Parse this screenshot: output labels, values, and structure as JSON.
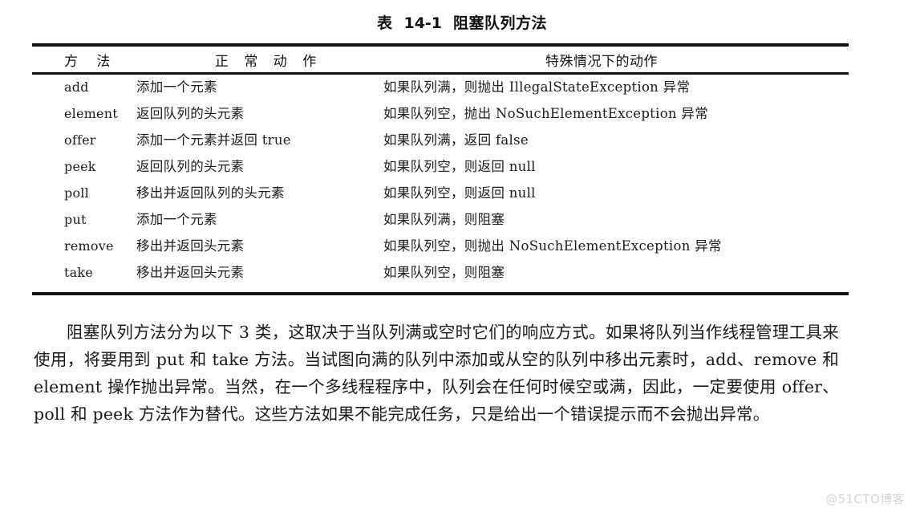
{
  "caption": {
    "prefix": "表",
    "number": "14-1",
    "title": "阻塞队列方法"
  },
  "table": {
    "headers": {
      "method": "方 法",
      "normal_action": "正 常 动 作",
      "special_action": "特殊情况下的动作"
    },
    "rows": [
      {
        "method": "add",
        "normal": "添加一个元素",
        "special": "如果队列满，则抛出 IllegalStateException 异常"
      },
      {
        "method": "element",
        "normal": "返回队列的头元素",
        "special": "如果队列空，抛出 NoSuchElementException 异常"
      },
      {
        "method": "offer",
        "normal": "添加一个元素并返回 true",
        "special": "如果队列满，返回 false"
      },
      {
        "method": "peek",
        "normal": "返回队列的头元素",
        "special": "如果队列空，则返回 null"
      },
      {
        "method": "poll",
        "normal": "移出并返回队列的头元素",
        "special": "如果队列空，则返回 null"
      },
      {
        "method": "put",
        "normal": "添加一个元素",
        "special": "如果队列满，则阻塞"
      },
      {
        "method": "remove",
        "normal": "移出并返回头元素",
        "special": "如果队列空，则抛出 NoSuchElementException 异常"
      },
      {
        "method": "take",
        "normal": "移出并返回头元素",
        "special": "如果队列空，则阻塞"
      }
    ]
  },
  "body": {
    "paragraph": "阻塞队列方法分为以下 3 类，这取决于当队列满或空时它们的响应方式。如果将队列当作线程管理工具来使用，将要用到 put 和 take 方法。当试图向满的队列中添加或从空的队列中移出元素时，add、remove 和 element 操作抛出异常。当然，在一个多线程程序中，队列会在任何时候空或满，因此，一定要使用 offer、poll 和 peek 方法作为替代。这些方法如果不能完成任务，只是给出一个错误提示而不会抛出异常。"
  },
  "watermark": {
    "text": "@51CTO博客"
  }
}
